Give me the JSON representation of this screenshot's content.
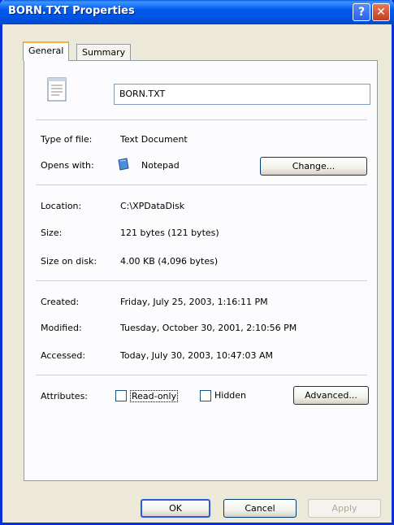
{
  "window": {
    "title": "BORN.TXT Properties"
  },
  "tabs": [
    {
      "label": "General"
    },
    {
      "label": "Summary"
    }
  ],
  "file": {
    "name": "BORN.TXT"
  },
  "labels": {
    "type": "Type of file:",
    "opens": "Opens with:",
    "location": "Location:",
    "size": "Size:",
    "size_on_disk": "Size on disk:",
    "created": "Created:",
    "modified": "Modified:",
    "accessed": "Accessed:",
    "attributes": "Attributes:"
  },
  "values": {
    "type": "Text Document",
    "opens": "Notepad",
    "location": "C:\\XPDataDisk",
    "size": "121 bytes (121 bytes)",
    "size_on_disk": "4.00 KB (4,096 bytes)",
    "created": "Friday, July 25, 2003, 1:16:11 PM",
    "modified": "Tuesday, October 30, 2001, 2:10:56 PM",
    "accessed": "Today, July 30, 2003, 10:47:03 AM"
  },
  "buttons": {
    "change": "Change...",
    "advanced": "Advanced...",
    "ok": "OK",
    "cancel": "Cancel",
    "apply": "Apply"
  },
  "attributes": {
    "read_only": "Read-only",
    "hidden": "Hidden"
  },
  "icons": {
    "file": "text-file-icon",
    "app": "notepad-icon",
    "help": "help-icon",
    "close": "close-icon"
  }
}
